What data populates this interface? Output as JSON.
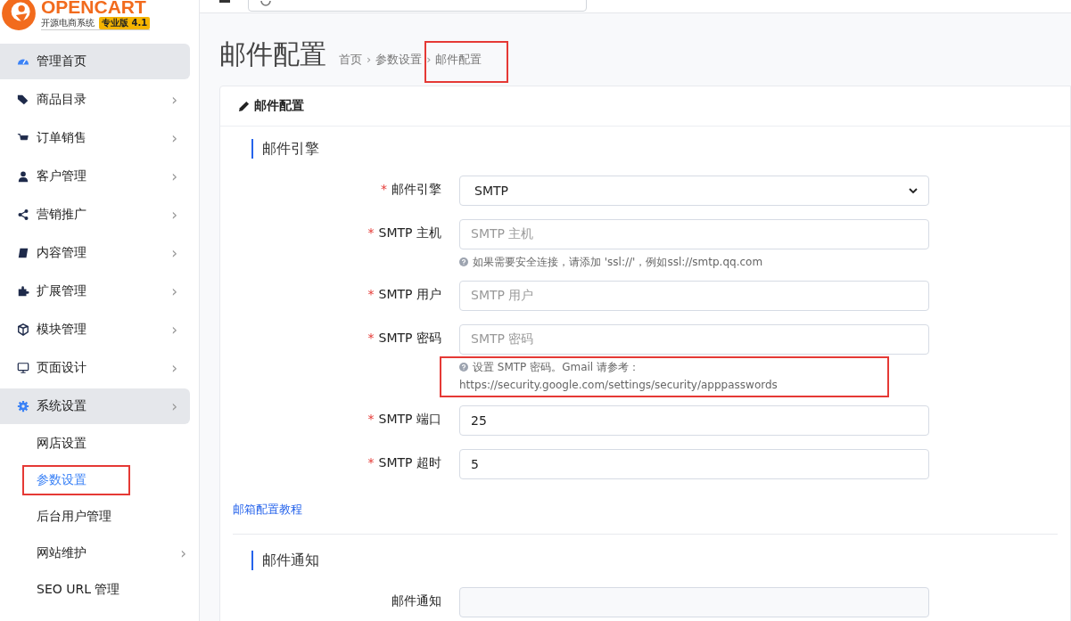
{
  "logo": {
    "name": "OPENCART",
    "subtitle": "开源电商系统",
    "badge": "专业版 4.1"
  },
  "sidebar": {
    "items": [
      {
        "label": "管理首页",
        "selected": true
      },
      {
        "label": "商品目录",
        "selected": false,
        "chevron": "›"
      },
      {
        "label": "订单销售",
        "selected": false,
        "chevron": "›"
      },
      {
        "label": "客户管理",
        "selected": false,
        "chevron": "›"
      },
      {
        "label": "营销推广",
        "selected": false,
        "chevron": "›"
      },
      {
        "label": "内容管理",
        "selected": false,
        "chevron": "›"
      },
      {
        "label": "扩展管理",
        "selected": false,
        "chevron": "›"
      },
      {
        "label": "模块管理",
        "selected": false,
        "chevron": "›"
      },
      {
        "label": "页面设计",
        "selected": false,
        "chevron": "›"
      },
      {
        "label": "系统设置",
        "selected": true,
        "chevron": "›",
        "children": [
          {
            "label": "网店设置",
            "selected": false,
            "highlighted": false
          },
          {
            "label": "参数设置",
            "selected": true,
            "highlighted": true
          },
          {
            "label": "后台用户管理",
            "selected": false,
            "highlighted": false
          },
          {
            "label": "网站维护",
            "selected": false,
            "highlighted": false,
            "chevron": "›"
          },
          {
            "label": "SEO URL 管理",
            "selected": false,
            "highlighted": false
          }
        ]
      }
    ]
  },
  "page": {
    "title": "邮件配置",
    "breadcrumb": [
      {
        "label": "首页",
        "highlighted": false
      },
      {
        "separator": "›",
        "label": "参数设置",
        "highlighted": false
      },
      {
        "separator": "›",
        "label": "邮件配置",
        "highlighted": true
      }
    ]
  },
  "card": {
    "title": "邮件配置",
    "sections": [
      {
        "title": "邮件引擎",
        "fields": [
          {
            "kind": "select",
            "marker": "*",
            "label": "邮件引擎",
            "value": "SMTP"
          },
          {
            "kind": "input",
            "marker": "*",
            "label": "SMTP 主机",
            "placeholder": "SMTP 主机",
            "help": [
              "如果需要安全连接，请添加 'ssl://'，例如ssl://smtp.qq.com"
            ],
            "help_highlighted": false
          },
          {
            "kind": "input",
            "marker": "*",
            "label": "SMTP 用户",
            "placeholder": "SMTP 用户"
          },
          {
            "kind": "input",
            "marker": "*",
            "label": "SMTP 密码",
            "placeholder": "SMTP 密码",
            "help": [
              "设置 SMTP 密码。Gmail 请参考：",
              "https://security.google.com/settings/security/apppasswords"
            ],
            "help_highlighted": true
          },
          {
            "kind": "input",
            "marker": "*",
            "label": "SMTP 端口",
            "value": "25"
          },
          {
            "kind": "input",
            "marker": "*",
            "label": "SMTP 超时",
            "value": "5"
          }
        ],
        "link": "邮箱配置教程"
      },
      {
        "title": "邮件通知",
        "fields": [
          {
            "kind": "input",
            "label": "邮件通知"
          }
        ]
      }
    ]
  }
}
